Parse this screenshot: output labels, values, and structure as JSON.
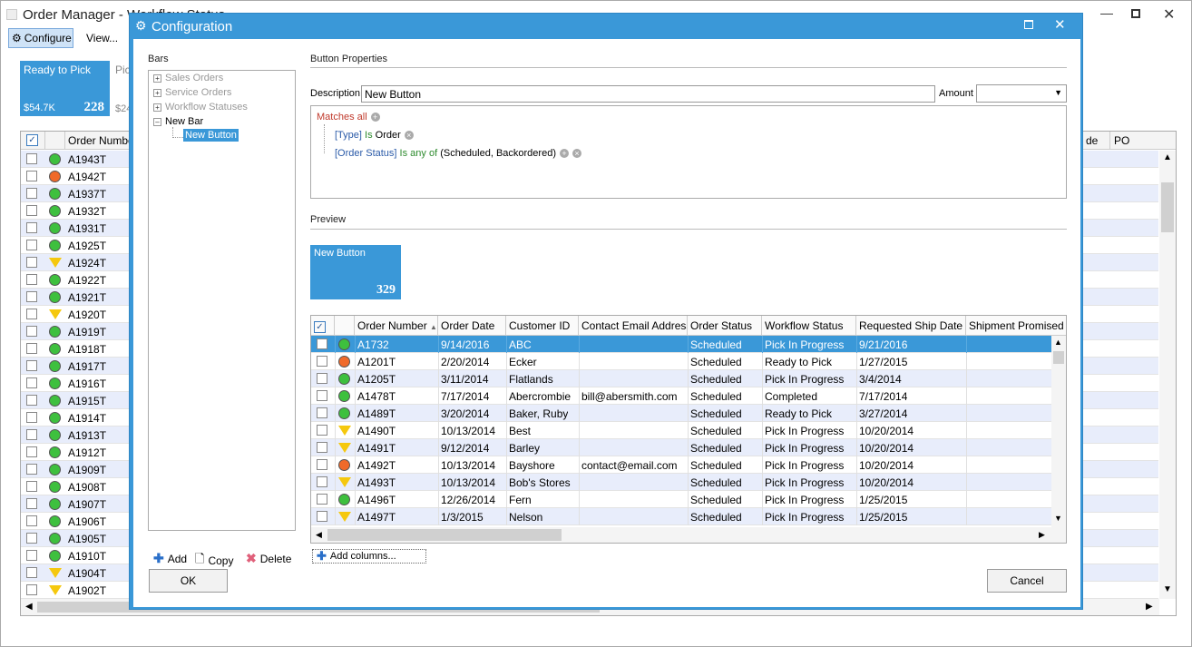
{
  "main": {
    "title": "Order Manager - Workflow Status",
    "toolbar": {
      "configure_label": "Configure",
      "view_label": "View..."
    },
    "tiles": [
      {
        "label": "Ready to Pick",
        "amount": "$54.7K",
        "count": "228"
      },
      {
        "label": "Pick",
        "amount": "$24"
      }
    ],
    "grid_headers": [
      "Order Number",
      "de",
      "PO"
    ],
    "rows": [
      {
        "num": "A1943T",
        "status": "green"
      },
      {
        "num": "A1942T",
        "status": "red"
      },
      {
        "num": "A1937T",
        "status": "green"
      },
      {
        "num": "A1932T",
        "status": "green"
      },
      {
        "num": "A1931T",
        "status": "green"
      },
      {
        "num": "A1925T",
        "status": "green"
      },
      {
        "num": "A1924T",
        "status": "yellow"
      },
      {
        "num": "A1922T",
        "status": "green"
      },
      {
        "num": "A1921T",
        "status": "green"
      },
      {
        "num": "A1920T",
        "status": "yellow"
      },
      {
        "num": "A1919T",
        "status": "green"
      },
      {
        "num": "A1918T",
        "status": "green"
      },
      {
        "num": "A1917T",
        "status": "green"
      },
      {
        "num": "A1916T",
        "status": "green"
      },
      {
        "num": "A1915T",
        "status": "green"
      },
      {
        "num": "A1914T",
        "status": "green"
      },
      {
        "num": "A1913T",
        "status": "green"
      },
      {
        "num": "A1912T",
        "status": "green"
      },
      {
        "num": "A1909T",
        "status": "green"
      },
      {
        "num": "A1908T",
        "status": "green"
      },
      {
        "num": "A1907T",
        "status": "green"
      },
      {
        "num": "A1906T",
        "status": "green"
      },
      {
        "num": "A1905T",
        "status": "green"
      },
      {
        "num": "A1910T",
        "status": "green"
      },
      {
        "num": "A1904T",
        "status": "yellow"
      },
      {
        "num": "A1902T",
        "status": "yellow"
      }
    ]
  },
  "dialog": {
    "title": "Configuration",
    "bars_label": "Bars",
    "tree": {
      "items": [
        "Sales Orders",
        "Service Orders",
        "Workflow Statuses",
        "New Bar"
      ],
      "child": "New Button"
    },
    "actions": {
      "add": "Add",
      "copy": "Copy",
      "delete": "Delete"
    },
    "button_properties_label": "Button Properties",
    "description_label": "Description",
    "description_value": "New Button",
    "amount_label": "Amount",
    "filter": {
      "matches": "Matches all",
      "rule1": {
        "field": "[Type]",
        "op": "Is",
        "value": "Order"
      },
      "rule2": {
        "field": "[Order Status]",
        "op": "Is any of",
        "value": "(Scheduled, Backordered)"
      }
    },
    "preview_label": "Preview",
    "preview_tile": {
      "label": "New Button",
      "count": "329"
    },
    "grid": {
      "headers": [
        "Order Number",
        "Order Date",
        "Customer ID",
        "Contact Email Address",
        "Order Status",
        "Workflow Status",
        "Requested Ship Date",
        "Shipment Promised Da"
      ],
      "rows": [
        {
          "status": "green",
          "num": "A1732",
          "date": "9/14/2016",
          "cust": "ABC",
          "email": "",
          "ostatus": "Scheduled",
          "wstatus": "Pick In Progress",
          "ship": "9/21/2016"
        },
        {
          "status": "red",
          "num": "A1201T",
          "date": "2/20/2014",
          "cust": "Ecker",
          "email": "",
          "ostatus": "Scheduled",
          "wstatus": "Ready to Pick",
          "ship": "1/27/2015"
        },
        {
          "status": "green",
          "num": "A1205T",
          "date": "3/11/2014",
          "cust": "Flatlands",
          "email": "",
          "ostatus": "Scheduled",
          "wstatus": "Pick In Progress",
          "ship": "3/4/2014"
        },
        {
          "status": "green",
          "num": "A1478T",
          "date": "7/17/2014",
          "cust": "Abercrombie",
          "email": "bill@abersmith.com",
          "ostatus": "Scheduled",
          "wstatus": "Completed",
          "ship": "7/17/2014"
        },
        {
          "status": "green",
          "num": "A1489T",
          "date": "3/20/2014",
          "cust": "Baker, Ruby",
          "email": "",
          "ostatus": "Scheduled",
          "wstatus": "Ready to Pick",
          "ship": "3/27/2014"
        },
        {
          "status": "yellow",
          "num": "A1490T",
          "date": "10/13/2014",
          "cust": "Best",
          "email": "",
          "ostatus": "Scheduled",
          "wstatus": "Pick In Progress",
          "ship": "10/20/2014"
        },
        {
          "status": "yellow",
          "num": "A1491T",
          "date": "9/12/2014",
          "cust": "Barley",
          "email": "",
          "ostatus": "Scheduled",
          "wstatus": "Pick In Progress",
          "ship": "10/20/2014"
        },
        {
          "status": "red",
          "num": "A1492T",
          "date": "10/13/2014",
          "cust": "Bayshore",
          "email": "contact@email.com",
          "ostatus": "Scheduled",
          "wstatus": "Pick In Progress",
          "ship": "10/20/2014"
        },
        {
          "status": "yellow",
          "num": "A1493T",
          "date": "10/13/2014",
          "cust": "Bob's Stores",
          "email": "",
          "ostatus": "Scheduled",
          "wstatus": "Pick In Progress",
          "ship": "10/20/2014"
        },
        {
          "status": "green",
          "num": "A1496T",
          "date": "12/26/2014",
          "cust": "Fern",
          "email": "",
          "ostatus": "Scheduled",
          "wstatus": "Pick In Progress",
          "ship": "1/25/2015"
        },
        {
          "status": "yellow",
          "num": "A1497T",
          "date": "1/3/2015",
          "cust": "Nelson",
          "email": "",
          "ostatus": "Scheduled",
          "wstatus": "Pick In Progress",
          "ship": "1/25/2015"
        }
      ]
    },
    "add_columns_label": "Add columns...",
    "ok_label": "OK",
    "cancel_label": "Cancel"
  }
}
